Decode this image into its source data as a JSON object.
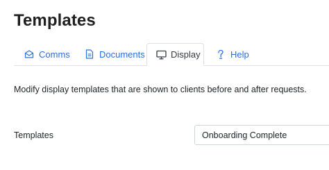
{
  "page": {
    "title": "Templates"
  },
  "tabs": [
    {
      "label": "Comms",
      "icon": "envelope-icon"
    },
    {
      "label": "Documents",
      "icon": "document-icon"
    },
    {
      "label": "Display",
      "icon": "monitor-icon",
      "active": true
    },
    {
      "label": "Help",
      "icon": "help-icon"
    }
  ],
  "colors": {
    "link": "#2a6fdb",
    "active_tab_text": "#343a40",
    "border": "#dee2e6"
  },
  "display_panel": {
    "description": "Modify display templates that are shown to clients before and after requests.",
    "templates_label": "Templates",
    "templates_selected": "Onboarding Complete"
  }
}
